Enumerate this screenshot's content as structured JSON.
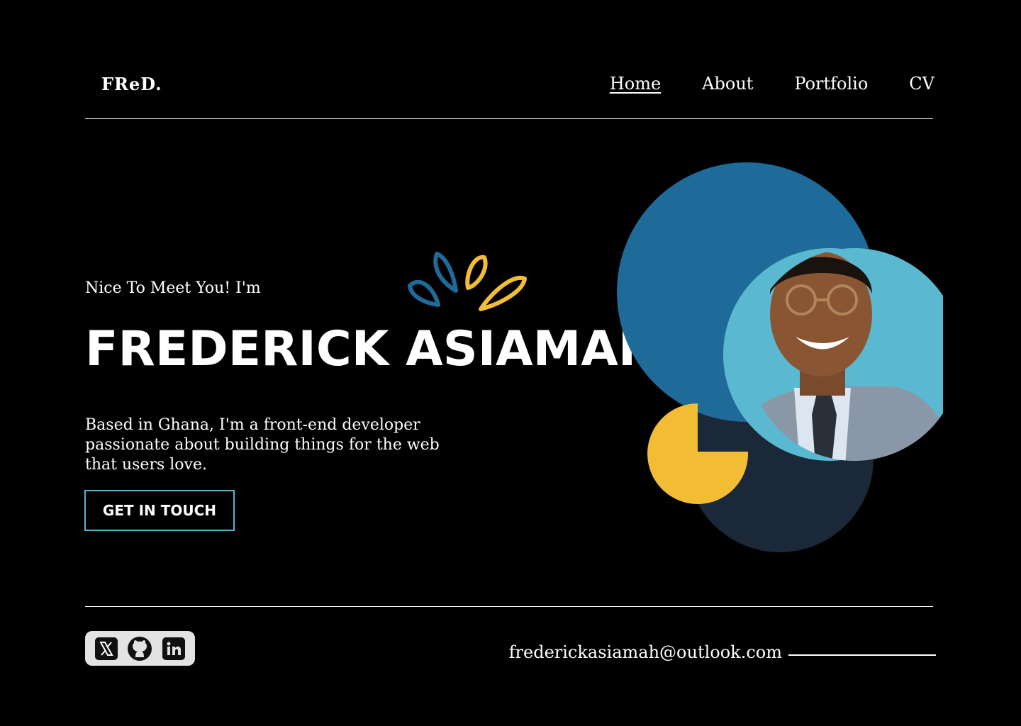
{
  "header": {
    "logo": "FReD.",
    "nav": [
      {
        "label": "Home"
      },
      {
        "label": "About"
      },
      {
        "label": "Portfolio"
      },
      {
        "label": "CV"
      }
    ],
    "active_nav": "Home"
  },
  "hero": {
    "greeting": "Nice To Meet You! I'm",
    "name": "FREDERICK ASIAMAH",
    "bio": "Based in Ghana, I'm a front-end developer passionate about building things for the web that users love.",
    "cta_label": "GET IN TOUCH"
  },
  "portrait": {
    "alt": "Photo of Frederick Asiamah"
  },
  "footer": {
    "socials": [
      {
        "icon": "x-twitter-icon"
      },
      {
        "icon": "github-icon"
      },
      {
        "icon": "linkedin-icon"
      }
    ],
    "email": "frederickasiamah@outlook.com"
  },
  "colors": {
    "background": "#000000",
    "blue_dark": "#1e6a99",
    "blue_light": "#5ab9d1",
    "yellow": "#f2bd35",
    "navy": "#1a2837",
    "cta_border": "#5ab4cf"
  }
}
